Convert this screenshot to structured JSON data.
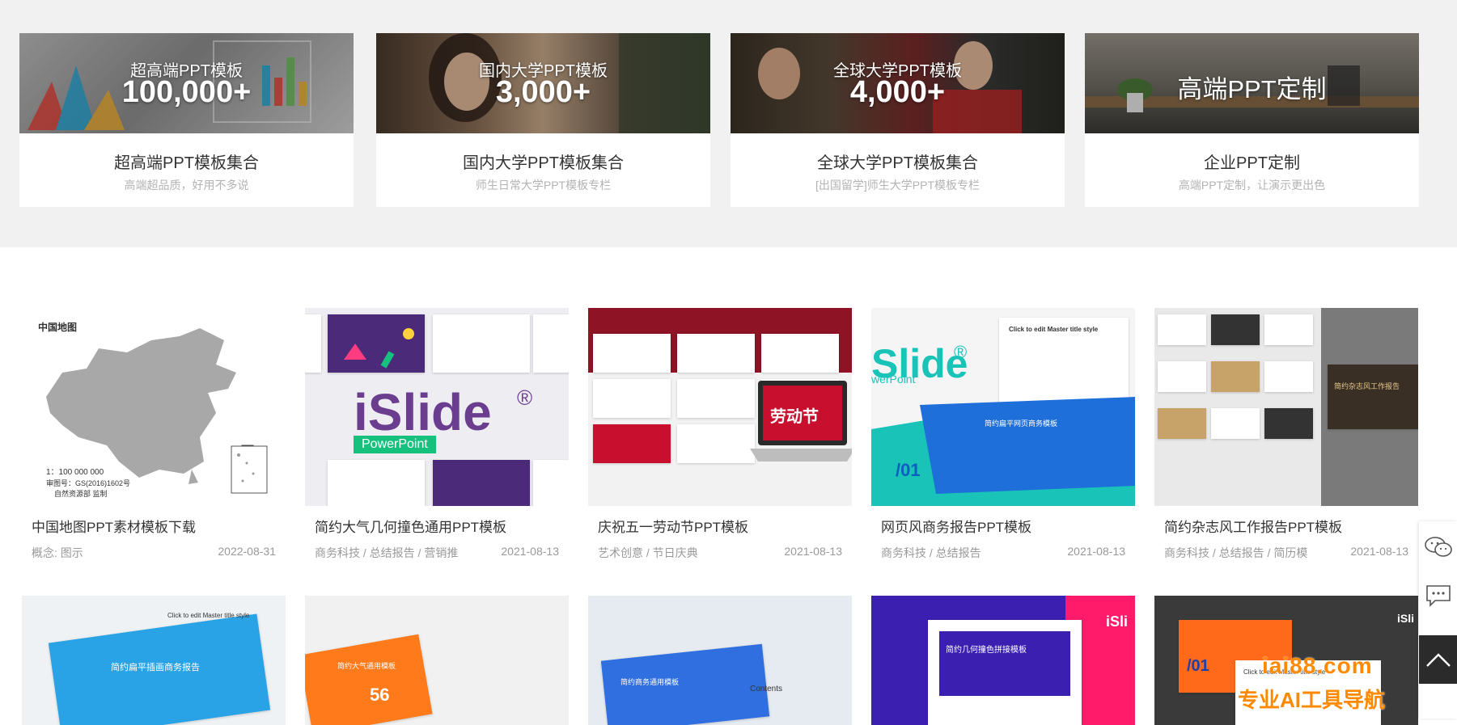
{
  "features": [
    {
      "banner_sub": "超高端PPT模板",
      "banner_big": "100,000+",
      "title": "超高端PPT模板集合",
      "subtitle": "高端超品质，好用不多说"
    },
    {
      "banner_sub": "国内大学PPT模板",
      "banner_big": "3,000+",
      "title": "国内大学PPT模板集合",
      "subtitle": "师生日常大学PPT模板专栏"
    },
    {
      "banner_sub": "全球大学PPT模板",
      "banner_big": "4,000+",
      "title": "全球大学PPT模板集合",
      "subtitle": "[出国留学]师生大学PPT模板专栏"
    },
    {
      "banner_only": "高端PPT定制",
      "title": "企业PPT定制",
      "subtitle": "高端PPT定制，让演示更出色"
    }
  ],
  "cards": [
    {
      "title": "中国地图PPT素材模板下载",
      "tags": "概念: 图示",
      "date": "2022-08-31",
      "thumb": {
        "map_label": "中国地图",
        "scale": "1：100 000 000",
        "review": "审图号：GS(2016)1602号",
        "maker": "自然资源部 监制"
      }
    },
    {
      "title": "简约大气几何撞色通用PPT模板",
      "tags": "商务科技 / 总结报告 / 营销推",
      "date": "2021-08-13",
      "thumb": {
        "brand": "iSlide",
        "reg": "®",
        "sub": "PowerPoint"
      }
    },
    {
      "title": "庆祝五一劳动节PPT模板",
      "tags": "艺术创意 / 节日庆典",
      "date": "2021-08-13",
      "thumb": {
        "screen_text": "劳动节"
      }
    },
    {
      "title": "网页风商务报告PPT模板",
      "tags": "商务科技 / 总结报告",
      "date": "2021-08-13",
      "thumb": {
        "brand": "Slide",
        "reg": "®",
        "sub": "werPoint",
        "section": "/01",
        "slide_title": "Click to edit Master title style",
        "slide_cn": "简约扁平网页商务模板"
      }
    },
    {
      "title": "简约杂志风工作报告PPT模板",
      "tags": "商务科技 / 总结报告 / 简历模",
      "date": "2021-08-13",
      "thumb": {
        "label": "简约杂志风工作报告"
      }
    }
  ],
  "second_row": [
    {
      "thumb": {
        "slide_title": "Click to edit Master title style",
        "slide_cn": "简约扁平插画商务报告"
      }
    },
    {
      "thumb": {
        "num": "56",
        "slide_cn": "简约大气通用模板"
      }
    },
    {
      "thumb": {
        "contents": "Contents",
        "slide_cn": "简约商务通用模板"
      }
    },
    {
      "thumb": {
        "brand": "iSli",
        "slide_cn": "简约几何撞色拼接模板"
      }
    },
    {
      "thumb": {
        "brand": "iSli",
        "section": "/01",
        "slide_title": "Click to edit Master title style"
      }
    }
  ],
  "watermark": {
    "site": "iai88.com",
    "slogan": "专业AI工具导航"
  },
  "colors": {
    "band": "#f1f1f1",
    "accent": "#ff8a00",
    "islide_purple": "#6b3d8f",
    "islide_green": "#16c17d",
    "red": "#c8102e",
    "teal": "#19c3b8"
  }
}
